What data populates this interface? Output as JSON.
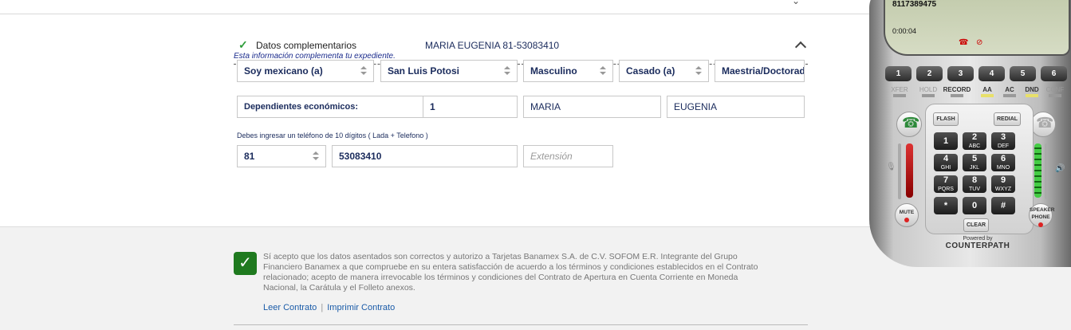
{
  "section": {
    "title": "Datos complementarios",
    "subtitle": "Esta información complementa tu expediente.",
    "name": "MARIA EUGENIA 81-53083410"
  },
  "form": {
    "row1": [
      "Soy mexicano (a)",
      "San Luis Potosi",
      "Masculino",
      "Casado (a)",
      "Maestria/Doctorado"
    ],
    "dependientes_label": "Dependientes económicos:",
    "dependientes_value": "1",
    "nombre": "MARIA",
    "apellido": "EUGENIA",
    "phone_hint": "Debes ingresar un teléfono de 10 dígitos ( Lada + Telefono )",
    "lada": "81",
    "telefono": "53083410",
    "extension_placeholder": "Extensión"
  },
  "footer": {
    "terms": "Sí acepto que los datos asentados son correctos y autorizo a Tarjetas Banamex S.A. de C.V. SOFOM E.R. Integrante del Grupo Financiero Banamex a que compruebe en su entera satisfacción de acuerdo a los términos y condiciones establecidos en el Contrato relacionado; acepto de manera irrevocable los términos y condiciones del Contrato de Apertura en Cuenta Corriente en Moneda Nacional, la Carátula y el Folleto anexos.",
    "link_leer": "Leer Contrato",
    "separator": "|",
    "link_imprimir": "Imprimir Contrato"
  },
  "softphone": {
    "number": "8117389475",
    "timer": "0:00:04",
    "lines": [
      "1",
      "2",
      "3",
      "4",
      "5",
      "6"
    ],
    "functions": [
      "XFER",
      "HOLD",
      "RECORD",
      "AA",
      "AC",
      "DND",
      "CONF"
    ],
    "flash": "FLASH",
    "redial": "REDIAL",
    "keys": [
      {
        "d": "1",
        "l": ""
      },
      {
        "d": "2",
        "l": "ABC"
      },
      {
        "d": "3",
        "l": "DEF"
      },
      {
        "d": "4",
        "l": "GHI"
      },
      {
        "d": "5",
        "l": "JKL"
      },
      {
        "d": "6",
        "l": "MNO"
      },
      {
        "d": "7",
        "l": "PQRS"
      },
      {
        "d": "8",
        "l": "TUV"
      },
      {
        "d": "9",
        "l": "WXYZ"
      },
      {
        "d": "*",
        "l": ""
      },
      {
        "d": "0",
        "l": ""
      },
      {
        "d": "#",
        "l": ""
      }
    ],
    "clear": "CLEAR",
    "mute": "MUTE",
    "speaker": "SPEAKER PHONE",
    "powered": "Powered by",
    "brand": "COUNTERPATH"
  }
}
